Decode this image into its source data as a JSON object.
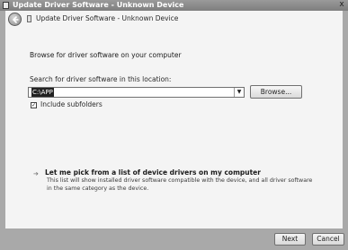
{
  "window": {
    "title": "Update Driver Software - Unknown Device",
    "close_glyph": "x"
  },
  "nav": {
    "title": "Update Driver Software - Unknown Device"
  },
  "main": {
    "heading": "Browse for driver software on your computer",
    "search_label": "Search for driver software in this location:",
    "location_value": "C:\\APP",
    "browse_label": "Browse...",
    "include_subfolders_label": "Include subfolders",
    "include_subfolders_checked": true,
    "pick_arrow": "➔",
    "pick_title": "Let me pick from a list of device drivers on my computer",
    "pick_description": "This list will show installed driver software compatible with the device, and all driver software in the same category as the device."
  },
  "footer": {
    "next_label": "Next",
    "cancel_label": "Cancel"
  },
  "icons": {
    "title": "device-icon",
    "nav": "device-icon",
    "back": "back-arrow-icon",
    "dropdown": "chevron-down-icon",
    "check": "checkmark-icon"
  }
}
